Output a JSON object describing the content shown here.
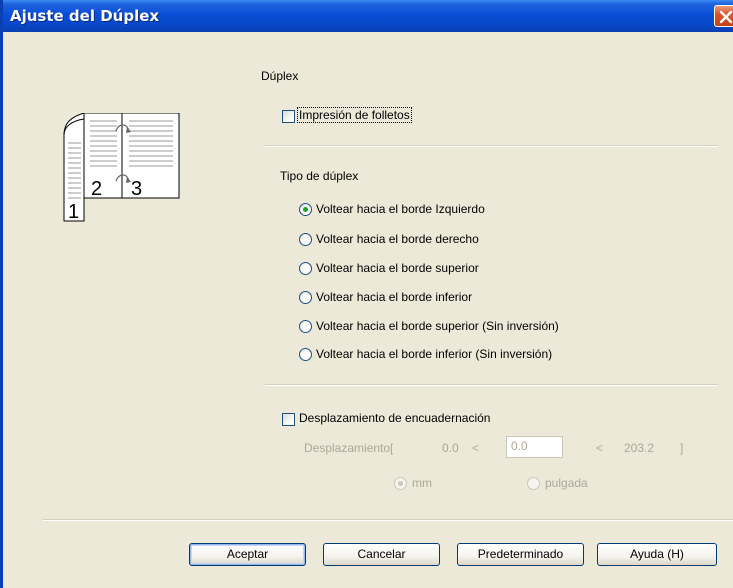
{
  "window": {
    "title": "Ajuste del Dúplex"
  },
  "duplex": {
    "heading": "Dúplex",
    "booklet_label": "Impresión de folletos",
    "booklet_checked": false
  },
  "illustration": {
    "page_left": "2",
    "page_right": "3",
    "page_front": "1"
  },
  "duplex_type": {
    "heading": "Tipo de dúplex",
    "selected_index": 0,
    "options": [
      "Voltear hacia el borde Izquierdo",
      "Voltear hacia el borde derecho",
      "Voltear hacia el borde superior",
      "Voltear hacia el borde inferior",
      "Voltear hacia el borde superior (Sin inversión)",
      "Voltear hacia el borde inferior (Sin inversión)"
    ]
  },
  "binding_offset": {
    "checkbox_label": "Desplazamiento de encuadernación",
    "checked": false,
    "offset_label": "Desplazamiento[",
    "min_value": "0.0",
    "less_than": "<",
    "value": "0.0",
    "max_value": "203.2",
    "close_bracket": "]",
    "unit_mm": "mm",
    "unit_inch": "pulgada",
    "selected_unit": "mm"
  },
  "buttons": {
    "ok": "Aceptar",
    "cancel": "Cancelar",
    "default": "Predeterminado",
    "help": "Ayuda (H)"
  },
  "colors": {
    "titlebar": "#0a4ed6",
    "dialog_bg": "#ece9d8",
    "radio_selected": "#21a121",
    "disabled_text": "#aca899"
  }
}
